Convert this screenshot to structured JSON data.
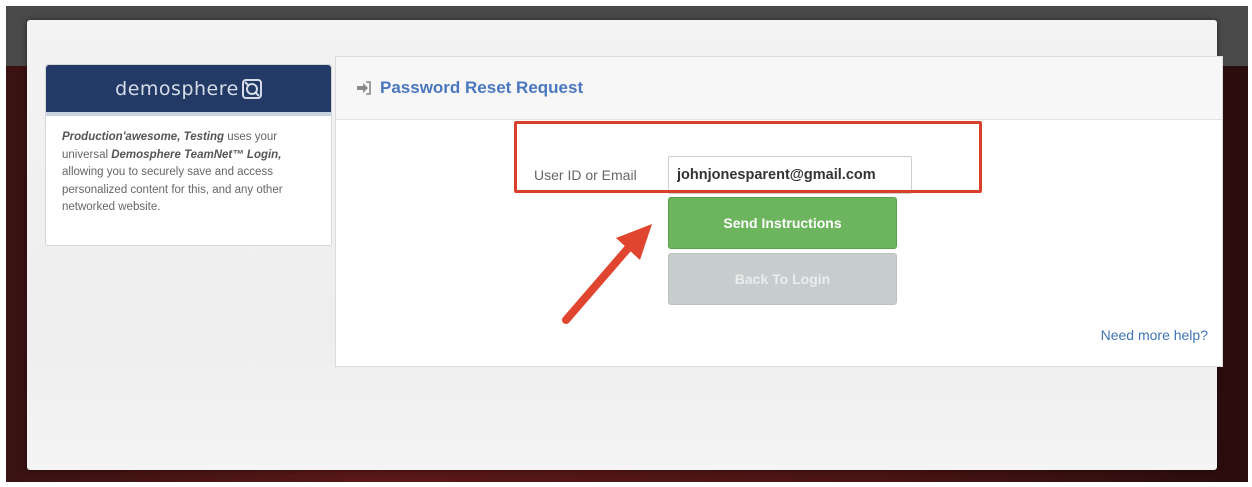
{
  "brand": {
    "name": "demosphere"
  },
  "info": {
    "org": "Production'awesome, Testing",
    "text1": " uses your universal ",
    "product": "Demosphere TeamNet™ Login,",
    "text2": " allowing you to securely save and access personalized content for this, and any other networked website."
  },
  "panel": {
    "header_icon": "sign-in-icon",
    "title": "Password Reset Request"
  },
  "form": {
    "label": "User ID or Email",
    "value": "johnjonesparent@gmail.com"
  },
  "buttons": {
    "send": "Send Instructions",
    "back": "Back To Login"
  },
  "help": {
    "label": "Need more help?"
  },
  "colors": {
    "brand_bar": "#243a66",
    "title": "#4a77c0",
    "send_button": "#6cb45e",
    "back_button": "#c7cdcc",
    "annotation": "#d9402c"
  }
}
